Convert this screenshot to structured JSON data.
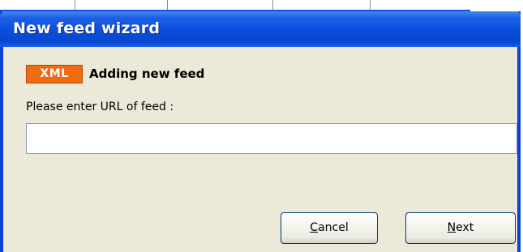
{
  "window": {
    "title": "New feed wizard"
  },
  "header": {
    "badge": "XML",
    "heading": "Adding new feed"
  },
  "form": {
    "url_label": "Please enter URL of feed :",
    "url_value": "",
    "url_placeholder": ""
  },
  "buttons": {
    "cancel": {
      "mnemonic": "C",
      "rest": "ancel"
    },
    "next": {
      "mnemonic": "N",
      "rest": "ext"
    }
  },
  "colors": {
    "titlebar": "#0a4ddb",
    "dialog_background": "#ece9d8",
    "badge_background": "#f06a0f",
    "title_text": "#ffffff"
  }
}
